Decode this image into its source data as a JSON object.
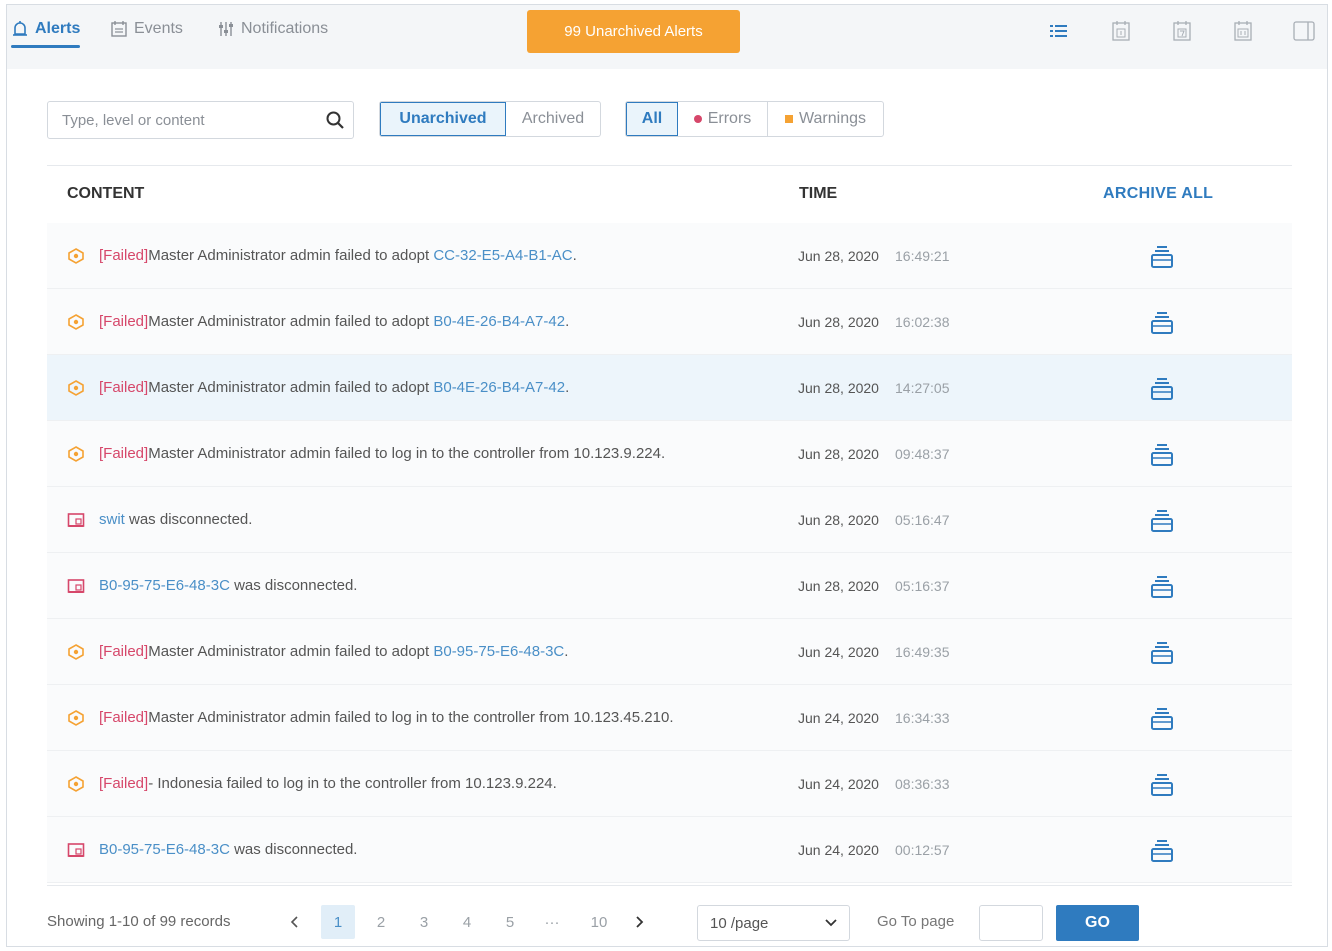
{
  "tabs": [
    {
      "label": "Alerts",
      "icon": "alarm-bell-icon",
      "active": true
    },
    {
      "label": "Events",
      "icon": "calendar-list-icon",
      "active": false
    },
    {
      "label": "Notifications",
      "icon": "sliders-icon",
      "active": false
    }
  ],
  "banner": "99 Unarchived Alerts",
  "view_icons": [
    "list-view-icon",
    "day-calendar-icon",
    "week-calendar-icon",
    "month-calendar-icon",
    "panel-layout-icon"
  ],
  "search": {
    "placeholder": "Type, level or content"
  },
  "archive_filter": {
    "options": [
      "Unarchived",
      "Archived"
    ],
    "selected": "Unarchived"
  },
  "level_filter": {
    "all": "All",
    "errors": "Errors",
    "warnings": "Warnings",
    "selected": "All",
    "errors_color": "#d6476a",
    "warnings_color": "#f5a233"
  },
  "table": {
    "headers": {
      "content": "CONTENT",
      "time": "TIME",
      "archive_all": "ARCHIVE ALL"
    },
    "rows": [
      {
        "type": "warning",
        "failed": "[Failed]",
        "text": "Master Administrator admin failed to adopt ",
        "link": "CC-32-E5-A4-B1-AC",
        "suffix": ".",
        "date": "Jun 28, 2020",
        "time": "16:49:21"
      },
      {
        "type": "warning",
        "failed": "[Failed]",
        "text": "Master Administrator admin failed to adopt ",
        "link": "B0-4E-26-B4-A7-42",
        "suffix": ".",
        "date": "Jun 28, 2020",
        "time": "16:02:38"
      },
      {
        "type": "warning",
        "failed": "[Failed]",
        "text": "Master Administrator admin failed to adopt ",
        "link": "B0-4E-26-B4-A7-42",
        "suffix": ".",
        "date": "Jun 28, 2020",
        "time": "14:27:05",
        "highlight": true
      },
      {
        "type": "warning",
        "failed": "[Failed]",
        "text": "Master Administrator admin failed to log in to the controller from 10.123.9.224.",
        "link": "",
        "suffix": "",
        "date": "Jun 28, 2020",
        "time": "09:48:37"
      },
      {
        "type": "device",
        "failed": "",
        "text": "",
        "link": "swit",
        "suffix": " was disconnected.",
        "date": "Jun 28, 2020",
        "time": "05:16:47"
      },
      {
        "type": "device",
        "failed": "",
        "text": "",
        "link": "B0-95-75-E6-48-3C",
        "suffix": " was disconnected.",
        "date": "Jun 28, 2020",
        "time": "05:16:37"
      },
      {
        "type": "warning",
        "failed": "[Failed]",
        "text": "Master Administrator admin failed to adopt ",
        "link": "B0-95-75-E6-48-3C",
        "suffix": ".",
        "date": "Jun 24, 2020",
        "time": "16:49:35"
      },
      {
        "type": "warning",
        "failed": "[Failed]",
        "text": "Master Administrator admin failed to log in to the controller from 10.123.45.210.",
        "link": "",
        "suffix": "",
        "date": "Jun 24, 2020",
        "time": "16:34:33"
      },
      {
        "type": "warning",
        "failed": "[Failed]",
        "text": "- Indonesia failed to log in to the controller from 10.123.9.224.",
        "link": "",
        "suffix": "",
        "date": "Jun 24, 2020",
        "time": "08:36:33"
      },
      {
        "type": "device",
        "failed": "",
        "text": "",
        "link": "B0-95-75-E6-48-3C",
        "suffix": " was disconnected.",
        "date": "Jun 24, 2020",
        "time": "00:12:57"
      }
    ]
  },
  "pagination": {
    "records": "Showing 1-10 of 99 records",
    "pages": [
      "1",
      "2",
      "3",
      "4",
      "5",
      "···",
      "10"
    ],
    "current": "1",
    "per_page": "10 /page",
    "goto_label": "Go To page",
    "goto_value": "",
    "go_button": "GO"
  },
  "colors": {
    "accent": "#2f7bbf",
    "banner": "#f5a233",
    "failed": "#d6476a",
    "link": "#4a8fc7",
    "warning_icon": "#f5a233",
    "device_icon": "#d6476a"
  }
}
